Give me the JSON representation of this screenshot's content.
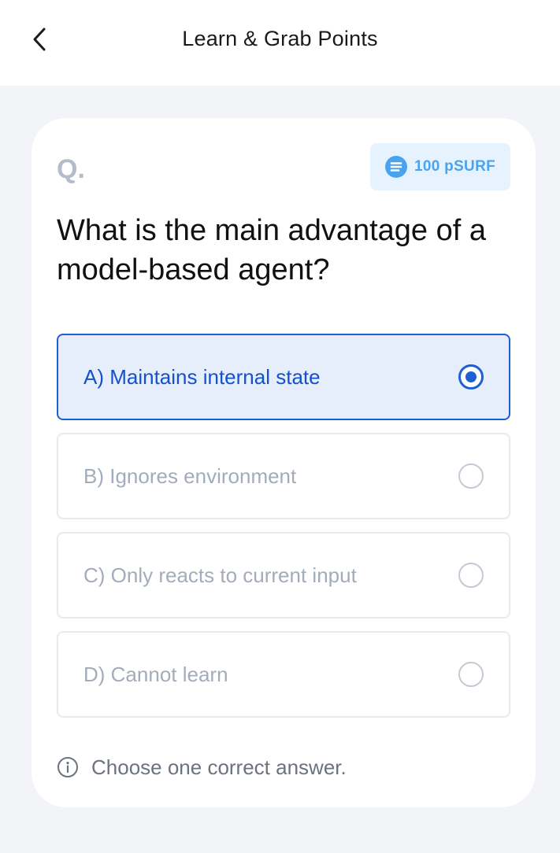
{
  "header": {
    "title": "Learn & Grab Points",
    "back_icon": "chevron-left-icon"
  },
  "quiz": {
    "q_mark": "Q.",
    "reward": {
      "amount_text": "100 pSURF",
      "icon": "psurf-token-icon",
      "color": "#4aa3ef"
    },
    "question": "What is the main advantage of a model-based agent?",
    "options": [
      {
        "label": "A) Maintains internal state",
        "selected": true
      },
      {
        "label": "B) Ignores environment",
        "selected": false
      },
      {
        "label": "C) Only reacts to current input",
        "selected": false
      },
      {
        "label": "D) Cannot learn",
        "selected": false
      }
    ],
    "hint": {
      "icon": "info-icon",
      "text": "Choose one correct answer."
    }
  },
  "colors": {
    "accent": "#1f5fd6",
    "selected_bg": "#e6eefc",
    "page_bg": "#f2f4f7"
  }
}
